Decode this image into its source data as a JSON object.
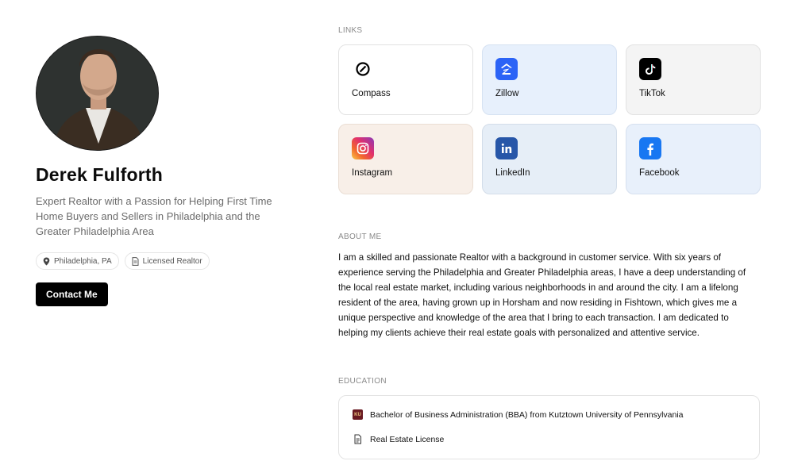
{
  "profile": {
    "name": "Derek Fulforth",
    "tagline": "Expert Realtor with a Passion for Helping First Time Home Buyers and Sellers in Philadelphia and the Greater Philadelphia Area",
    "location": "Philadelphia, PA",
    "license": "Licensed Realtor",
    "contact_label": "Contact Me"
  },
  "links": {
    "section_label": "LINKS",
    "items": [
      {
        "label": "Compass",
        "icon": "compass-icon",
        "color": "#000000"
      },
      {
        "label": "Zillow",
        "icon": "zillow-icon",
        "color": "#2b63f6"
      },
      {
        "label": "TikTok",
        "icon": "tiktok-icon",
        "color": "#000000"
      },
      {
        "label": "Instagram",
        "icon": "instagram-icon",
        "color": "#e1306c"
      },
      {
        "label": "LinkedIn",
        "icon": "linkedin-icon",
        "color": "#2756a8"
      },
      {
        "label": "Facebook",
        "icon": "facebook-icon",
        "color": "#1877f2"
      }
    ]
  },
  "about": {
    "section_label": "ABOUT ME",
    "text": "I am a skilled and passionate Realtor with a background in customer service. With six years of experience serving the Philadelphia and Greater Philadelphia areas, I have a deep understanding of the local real estate market, including various neighborhoods in and around the city. I am a lifelong resident of the area, having grown up in Horsham and now residing in Fishtown, which gives me a unique perspective and knowledge of the area that I bring to each transaction. I am dedicated to helping my clients achieve their real estate goals with personalized and attentive service."
  },
  "education": {
    "section_label": "EDUCATION",
    "items": [
      {
        "label": "Bachelor of Business Administration (BBA) from Kutztown University of Pennsylvania",
        "icon": "university-logo-icon"
      },
      {
        "label": "Real Estate License",
        "icon": "document-icon"
      }
    ]
  }
}
